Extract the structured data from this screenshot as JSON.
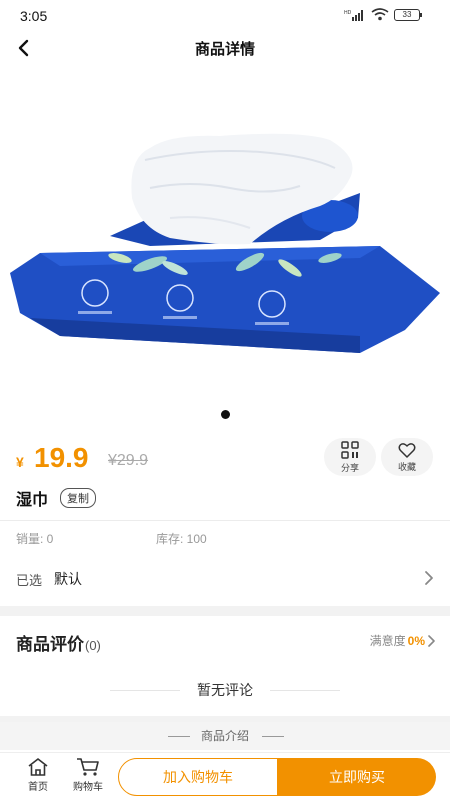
{
  "status_bar": {
    "time": "3:05",
    "battery": "33",
    "network_badge": "HD"
  },
  "nav": {
    "title": "商品详情"
  },
  "product": {
    "currency": "¥",
    "price": "19.9",
    "original_price": "¥29.9",
    "name": "湿巾",
    "copy_label": "复制",
    "sales_label": "销量: 0",
    "stock_label": "库存: 100",
    "selected_label": "已选",
    "selected_value": "默认",
    "image_icon_names": [
      "wet-wipes-package-image"
    ]
  },
  "actions": {
    "share_label": "分享",
    "favorite_label": "收藏"
  },
  "reviews": {
    "title": "商品评价",
    "count": "(0)",
    "satisfaction_label": "满意度",
    "satisfaction_value": "0%",
    "empty_text": "暂无评论"
  },
  "intro": {
    "label": "商品介绍"
  },
  "bottom": {
    "home_label": "首页",
    "cart_tab_label": "购物车",
    "add_cart_label": "加入购物车",
    "buy_now_label": "立即购买"
  },
  "colors": {
    "accent": "#f29100",
    "package_blue": "#1f4fc4"
  }
}
